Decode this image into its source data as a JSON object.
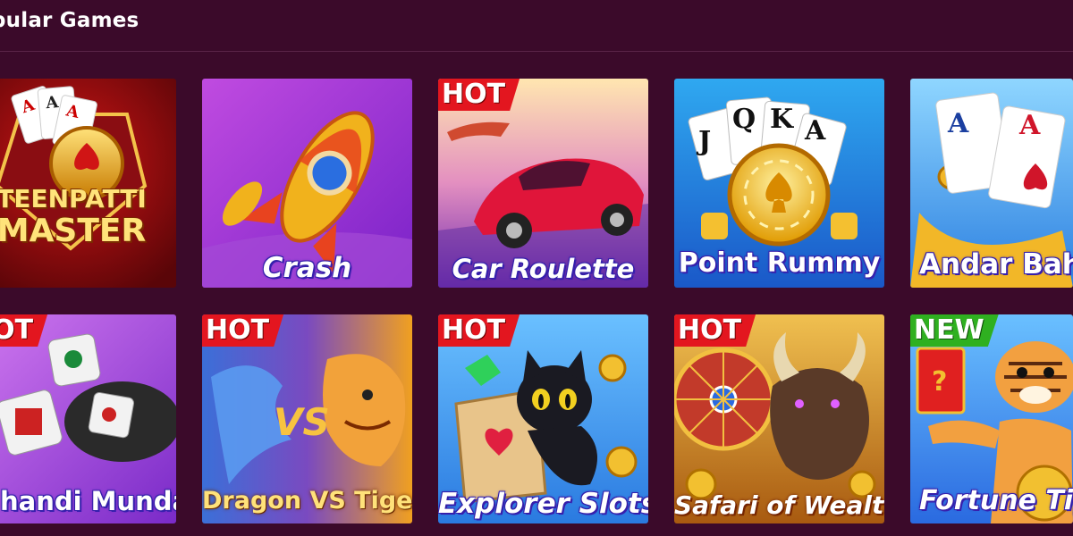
{
  "section": {
    "title": "pular Games"
  },
  "badges": {
    "hot": "HOT",
    "new": "NEW"
  },
  "games": [
    {
      "name": "TEENPATTI MASTER",
      "badge": ""
    },
    {
      "name": "Crash",
      "badge": ""
    },
    {
      "name": "Car Roulette",
      "badge": "HOT"
    },
    {
      "name": "Point Rummy",
      "badge": ""
    },
    {
      "name": "Andar Bah",
      "badge": ""
    },
    {
      "name": "handi Munda",
      "badge": "HOT"
    },
    {
      "name": "Dragon VS Tiger",
      "badge": "HOT"
    },
    {
      "name": "Explorer Slots",
      "badge": "HOT"
    },
    {
      "name": "Safari of Wealth",
      "badge": "HOT"
    },
    {
      "name": "Fortune Tig",
      "badge": "NEW"
    }
  ],
  "card_art": {
    "teenpatti": {
      "line1": "TEENPATTI",
      "line2": "MASTER"
    },
    "point_rummy": {
      "cards": [
        "J",
        "Q",
        "K",
        "A"
      ]
    },
    "andar_bahar": {
      "cards": [
        "A",
        "A"
      ]
    }
  },
  "colors": {
    "page_bg": "#3b0a2a",
    "hot_badge": "#e3161f",
    "new_badge": "#2fb020"
  }
}
